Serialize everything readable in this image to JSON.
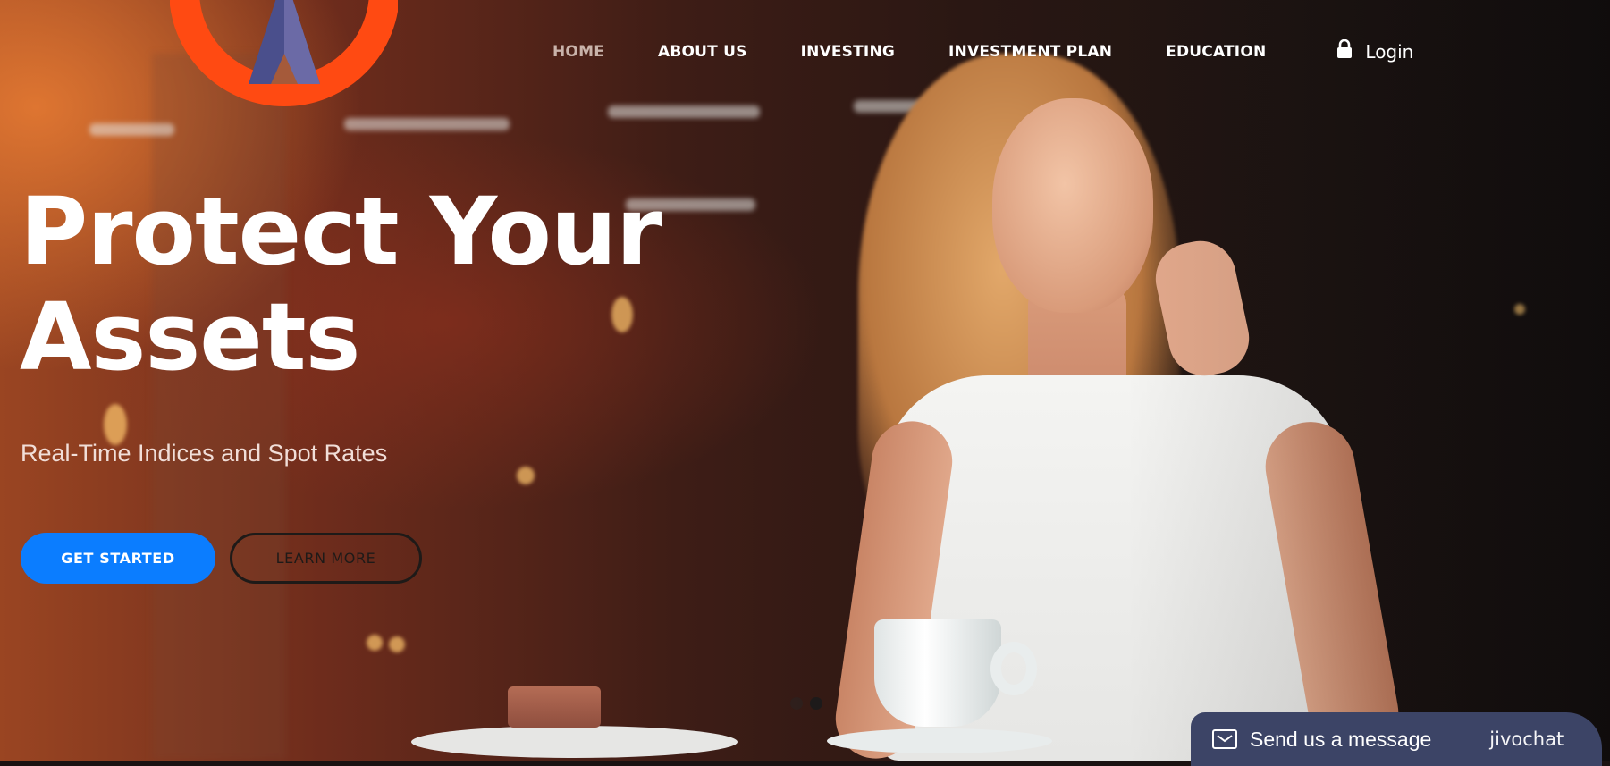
{
  "brand": {
    "logo_icon": "logo-ring-a-icon",
    "ring_color": "#ff4a12",
    "a_color": "#4a4f8c"
  },
  "nav": {
    "items": [
      {
        "label": "HOME",
        "active": true
      },
      {
        "label": "ABOUT US",
        "active": false
      },
      {
        "label": "INVESTING",
        "active": false
      },
      {
        "label": "INVESTMENT PLAN",
        "active": false
      },
      {
        "label": "EDUCATION",
        "active": false
      }
    ],
    "login_label": "Login",
    "login_icon": "lock-icon"
  },
  "hero": {
    "title_line1": "Protect Your",
    "title_line2": "Assets",
    "subtitle": "Real-Time Indices and Spot Rates",
    "primary_button": "GET STARTED",
    "secondary_button": "LEARN MORE",
    "primary_color": "#0b7dff",
    "slides_total": 2,
    "slide_active": 2
  },
  "chat_widget": {
    "icon": "mail-icon",
    "message": "Send us a message",
    "brand": "jivochat",
    "bg_color": "#3c4466"
  }
}
